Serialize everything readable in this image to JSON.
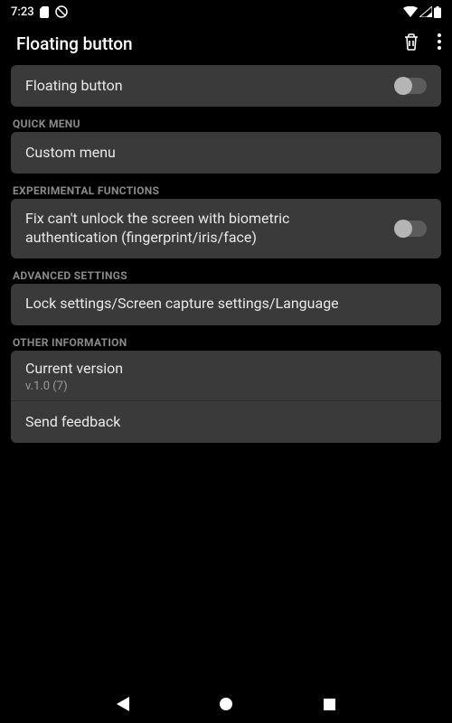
{
  "statusBar": {
    "time": "7:23"
  },
  "appBar": {
    "title": "Floating button"
  },
  "items": {
    "floatingButton": {
      "label": "Floating button"
    }
  },
  "sections": {
    "quickMenu": {
      "header": "QUICK MENU",
      "customMenu": "Custom menu"
    },
    "experimental": {
      "header": "EXPERIMENTAL FUNCTIONS",
      "biometricFix": "Fix can't unlock the screen with biometric authentication (fingerprint/iris/face)"
    },
    "advanced": {
      "header": "ADVANCED SETTINGS",
      "lockSettings": "Lock settings/Screen capture settings/Language"
    },
    "otherInfo": {
      "header": "OTHER INFORMATION",
      "currentVersion": {
        "label": "Current version",
        "value": "v.1.0 (7)"
      },
      "sendFeedback": "Send feedback"
    }
  }
}
